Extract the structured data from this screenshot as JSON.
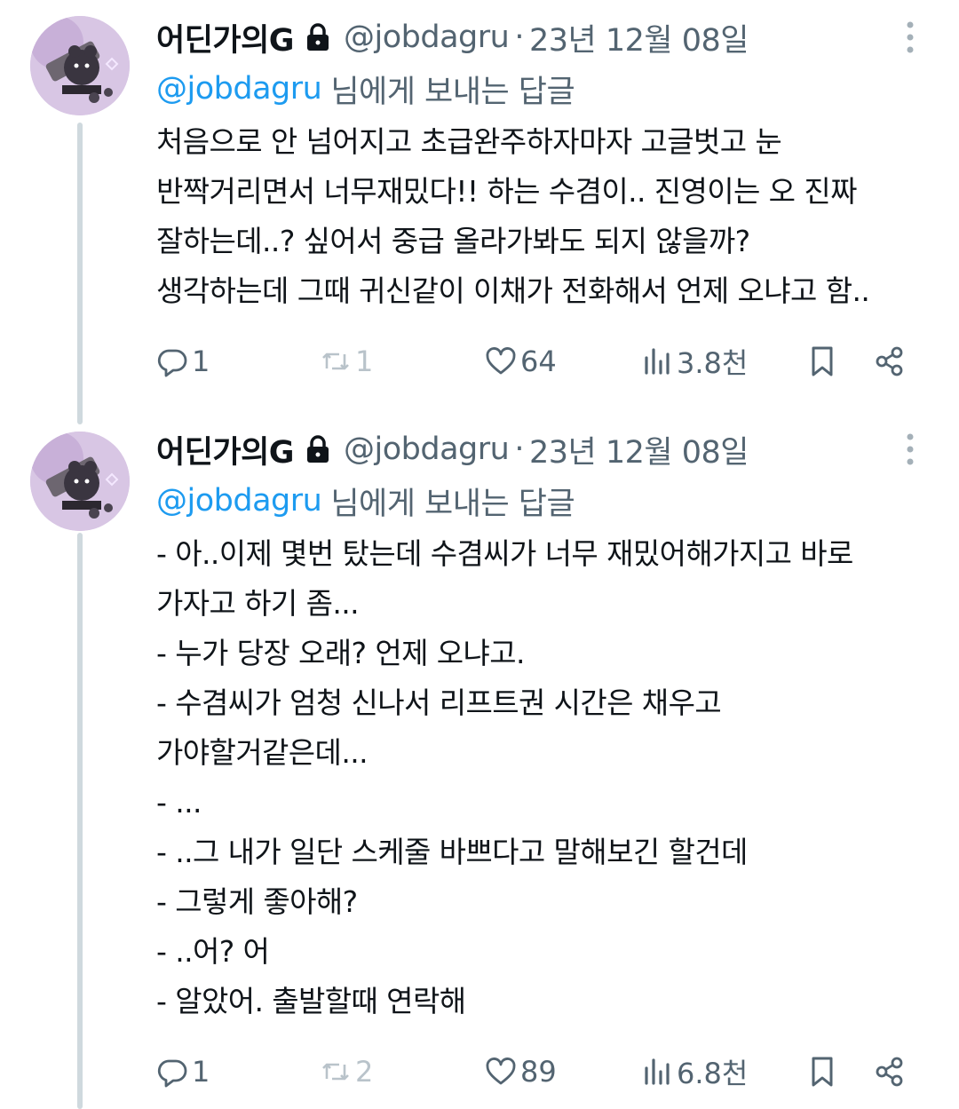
{
  "tweets": [
    {
      "author": {
        "display_name": "어딘가의G",
        "handle": "@jobdagru",
        "avatar": "avatar-image"
      },
      "date": "23년 12월 08일",
      "reply_to": {
        "mention": "@jobdagru",
        "suffix": "님에게 보내는 답글"
      },
      "lines": [
        "처음으로 안 넘어지고 초급완주하자마자 고글벗고 눈",
        "반짝거리면서 너무재밌다!! 하는 수겸이.. 진영이는 오 진짜",
        "잘하는데..? 싶어서 중급 올라가봐도 되지 않을까?",
        "생각하는데 그때 귀신같이 이채가 전화해서 언제 오냐고 함.."
      ],
      "stats": {
        "replies": "1",
        "retweets": "1",
        "likes": "64",
        "views": "3.8천"
      }
    },
    {
      "author": {
        "display_name": "어딘가의G",
        "handle": "@jobdagru",
        "avatar": "avatar-image"
      },
      "date": "23년 12월 08일",
      "reply_to": {
        "mention": "@jobdagru",
        "suffix": "님에게 보내는 답글"
      },
      "lines": [
        "- 아..이제 몇번 탔는데 수겸씨가 너무 재밌어해가지고 바로",
        "가자고 하기 좀...",
        "- 누가 당장 오래? 언제 오냐고.",
        "- 수겸씨가 엄청 신나서 리프트권 시간은 채우고",
        "가야할거같은데...",
        "- ...",
        "- ..그 내가 일단 스케줄 바쁘다고 말해보긴 할건데",
        "- 그렇게 좋아해?",
        "- ..어? 어",
        "- 알았어. 출발할때 연락해"
      ],
      "stats": {
        "replies": "1",
        "retweets": "2",
        "likes": "89",
        "views": "6.8천"
      }
    }
  ],
  "separator": "·",
  "colors": {
    "link": "#1d9bf0",
    "secondary": "#536471",
    "thread_line": "#cfd9de"
  },
  "icons": [
    "lock-icon",
    "more-icon",
    "reply-icon",
    "retweet-icon",
    "like-icon",
    "views-icon",
    "bookmark-icon",
    "share-icon"
  ]
}
